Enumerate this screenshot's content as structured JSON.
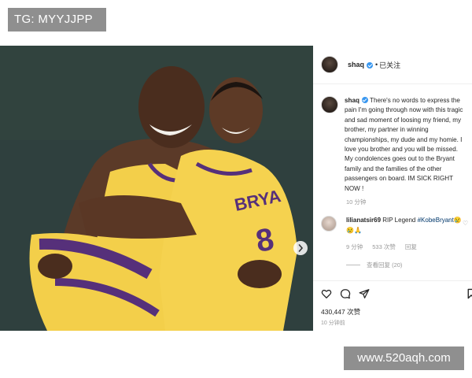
{
  "overlay": {
    "tg_label": "TG: MYYJJPP",
    "watermark": "www.520aqh.com"
  },
  "post": {
    "username": "shaq",
    "follow_dot": "•",
    "follow_status": "已关注",
    "caption_username": "shaq",
    "caption": "There's no words to express the pain I'm going through now with this tragic and sad moment of loosing my friend, my brother, my partner in winning championships, my dude and my homie. I love you brother and you will be missed. My condolences goes out to the Bryant family and the families of the other passengers on board. IM SICK RIGHT NOW !",
    "caption_time": "10 分钟",
    "comment": {
      "username": "lilianatsir69",
      "text": " RIP Legend ",
      "hashtag": "#KobeBryant",
      "emojis": "😢😢🙏",
      "time": "9 分钟",
      "likes": "533 次赞",
      "reply": "回复",
      "view_replies": "查看回复 (20)"
    },
    "likes": "430,447 次赞",
    "post_time": "10 分钟前"
  },
  "icons": {
    "verified": "verified-badge-icon",
    "heart": "heart-icon",
    "comment": "comment-icon",
    "share": "share-icon",
    "bookmark": "bookmark-icon",
    "next": "chevron-right-icon",
    "small_heart": "small-heart-icon"
  },
  "colors": {
    "verified_blue": "#3897f0",
    "hashtag": "#00376b",
    "muted": "#999999",
    "jersey_gold": "#f3cf4a",
    "jersey_purple": "#56307a"
  }
}
